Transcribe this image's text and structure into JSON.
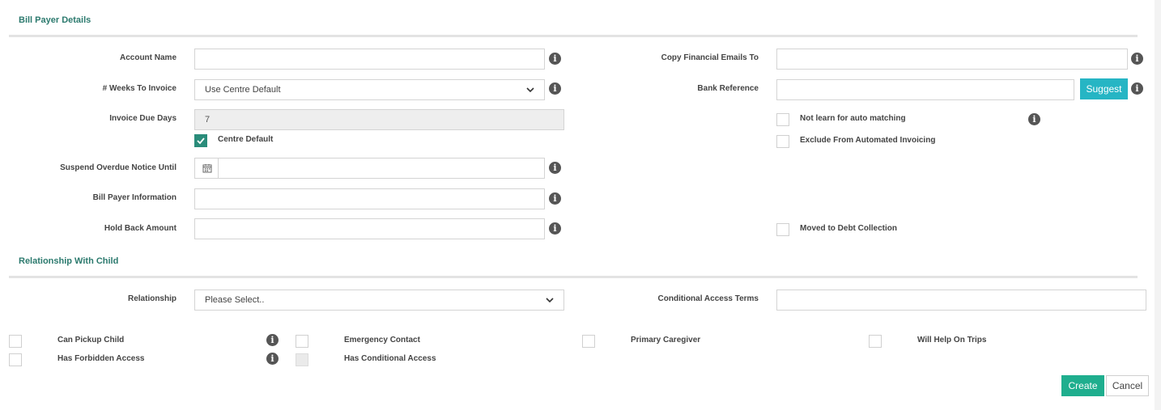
{
  "sections": {
    "bill_payer_title": "Bill Payer Details",
    "relationship_title": "Relationship With Child"
  },
  "bill_payer": {
    "account_name": {
      "label": "Account Name",
      "value": ""
    },
    "weeks_to_invoice": {
      "label": "# Weeks To Invoice",
      "value": "Use Centre Default"
    },
    "invoice_due_days": {
      "label": "Invoice Due Days",
      "value": "7"
    },
    "centre_default": {
      "label": "Centre Default",
      "checked": true
    },
    "suspend_overdue": {
      "label": "Suspend Overdue Notice Until",
      "value": ""
    },
    "bill_payer_info": {
      "label": "Bill Payer Information",
      "value": ""
    },
    "hold_back_amount": {
      "label": "Hold Back Amount",
      "value": ""
    },
    "copy_financial_emails": {
      "label": "Copy Financial Emails To",
      "value": ""
    },
    "bank_reference": {
      "label": "Bank Reference",
      "value": "",
      "suggest_label": "Suggest"
    },
    "not_learn_auto_matching": {
      "label": "Not learn for auto matching",
      "checked": false
    },
    "exclude_automated_invoicing": {
      "label": "Exclude From Automated Invoicing",
      "checked": false
    },
    "moved_to_debt_collection": {
      "label": "Moved to Debt Collection",
      "checked": false
    }
  },
  "relationship": {
    "relationship_select": {
      "label": "Relationship",
      "value": "Please Select.."
    },
    "conditional_access_terms": {
      "label": "Conditional Access Terms",
      "value": ""
    },
    "can_pickup_child": {
      "label": "Can Pickup Child",
      "checked": false
    },
    "has_forbidden_access": {
      "label": "Has Forbidden Access",
      "checked": false
    },
    "emergency_contact": {
      "label": "Emergency Contact",
      "checked": false
    },
    "has_conditional_access": {
      "label": "Has Conditional Access",
      "checked": false,
      "disabled": true
    },
    "primary_caregiver": {
      "label": "Primary Caregiver",
      "checked": false
    },
    "will_help_on_trips": {
      "label": "Will Help On Trips",
      "checked": false
    }
  },
  "actions": {
    "create_label": "Create",
    "cancel_label": "Cancel"
  },
  "icons": {
    "info": "info-icon",
    "calendar": "calendar-icon",
    "check": "check-icon",
    "chevron": "chevron-down-icon"
  },
  "colors": {
    "section_title": "#2c7a6e",
    "primary_button": "#1fae8e",
    "suggest_button": "#26b5c4",
    "checkbox_checked": "#2a8c7a"
  }
}
